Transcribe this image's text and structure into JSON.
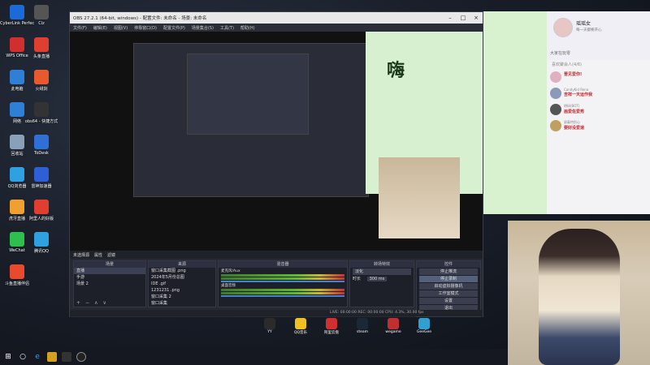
{
  "desktop_icons": [
    {
      "label": "CyberLink PerfectCa...",
      "color": "#1c6ad6"
    },
    {
      "label": "Ciz",
      "color": "#555"
    },
    {
      "label": "WPS Office",
      "color": "#d12e2e"
    },
    {
      "label": "头条直播",
      "color": "#e03e2e"
    },
    {
      "label": "此电脑",
      "color": "#2f7fd6"
    },
    {
      "label": "火绒剑",
      "color": "#e85a2e"
    },
    {
      "label": "网络",
      "color": "#2f7fd6"
    },
    {
      "label": "obs64 - 快捷方式",
      "color": "#333"
    },
    {
      "label": "回收站",
      "color": "#8aa0b8"
    },
    {
      "label": "ToDesk",
      "color": "#2f6fd6"
    },
    {
      "label": "QQ浏览器",
      "color": "#2fa0e0"
    },
    {
      "label": "雷神加速器",
      "color": "#2f5fd6"
    },
    {
      "label": "虎牙直播",
      "color": "#f0a030"
    },
    {
      "label": "阿里人的好版",
      "color": "#e03e2e"
    },
    {
      "label": "WeChat",
      "color": "#2fbf4f"
    },
    {
      "label": "腾讯QQ",
      "color": "#2fa0e0"
    },
    {
      "label": "斗鱼直播伴侣",
      "color": "#e84a2e"
    }
  ],
  "obs": {
    "title": "OBS 27.2.1 (64-bit, windows) - 配置文件: 未命名 - 场景: 未命名",
    "menu": [
      "文件(F)",
      "编辑(E)",
      "视图(V)",
      "停靠窗口(D)",
      "配置文件(P)",
      "场景集合(S)",
      "工具(T)",
      "帮助(H)"
    ],
    "top_tabs": [
      "未选择源",
      "属性",
      "滤镜"
    ],
    "panels": {
      "scenes": {
        "header": "场景",
        "items": [
          "直播",
          "手游",
          "场景 2"
        ]
      },
      "sources": {
        "header": "来源",
        "items": [
          "窗口采集截图 .png",
          "2024年5月份总图",
          "IDE .gif",
          "1231231 .png",
          "窗口采集 2",
          "窗口采集"
        ]
      },
      "mixer": {
        "header": "混音器",
        "tracks": [
          "麦克风/Aux",
          "桌面音频"
        ]
      },
      "transitions": {
        "header": "转场特效",
        "type": "淡化",
        "duration_label": "时长",
        "duration": "300 ms"
      },
      "controls": {
        "header": "控件",
        "buttons": [
          "停止推流",
          "停止录制",
          "启动虚拟摄像机",
          "工作室模式",
          "设置",
          "退出"
        ]
      }
    },
    "status": "LIVE: 00:00:00   REC: 00:00:00   CPU: 4.3%, 30.00 fps"
  },
  "preview_nested_text": "嗨",
  "taskbar_apps": [
    "YY",
    "QQ音乐",
    "阿里云盘",
    "steam",
    "wegame",
    "GeeGee"
  ],
  "chat": {
    "name": "瑶瑶女",
    "subtitle": "每一天都要开心",
    "section_title": "大家在玩零",
    "member_title": "喜欢聚会人(4/6)",
    "messages": [
      {
        "who": "",
        "text": "晋见爱你!"
      },
      {
        "who": "CandyKid Rena",
        "text": "吉祥一天运作我"
      },
      {
        "who": "明码(BOT)",
        "text": "画爱佐爱秀"
      },
      {
        "who": "屏蔽特别心",
        "text": "要好没爱速"
      }
    ],
    "side_text": "用户名"
  }
}
